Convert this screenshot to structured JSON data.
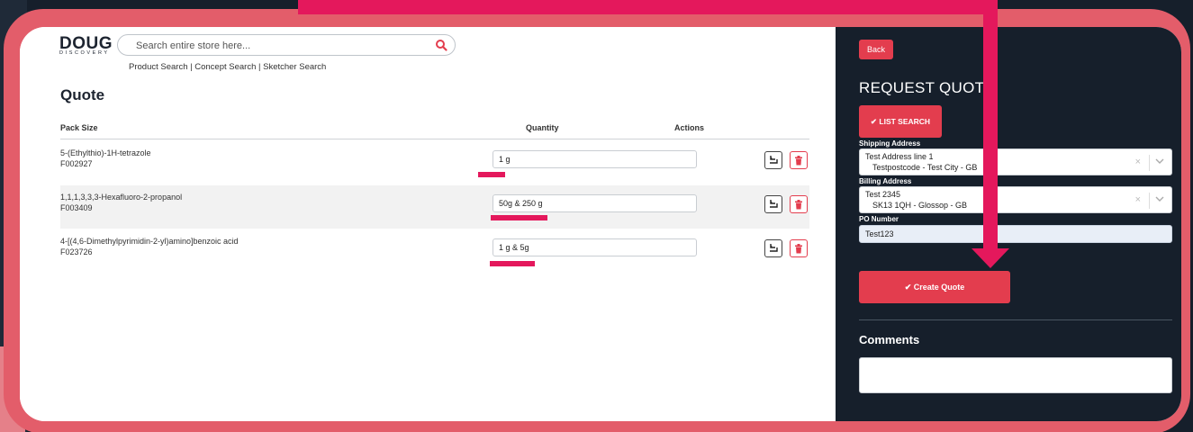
{
  "header": {
    "logo_main": "DOUG",
    "logo_sub": "DISCOVERY",
    "search_placeholder": "Search entire store here...",
    "links": [
      "Product Search",
      "Concept Search",
      "Sketcher Search"
    ],
    "link_separator": "|"
  },
  "quote": {
    "title": "Quote",
    "columns": {
      "pack_size": "Pack Size",
      "quantity": "Quantity",
      "actions": "Actions"
    },
    "items": [
      {
        "name": "5-(Ethylthio)-1H-tetrazole",
        "code": "F002927",
        "quantity": "1 g"
      },
      {
        "name": "1,1,1,3,3,3-Hexafluoro-2-propanol",
        "code": "F003409",
        "quantity": "50g & 250 g"
      },
      {
        "name": "4-[(4,6-Dimethylpyrimidin-2-yl)amino]benzoic acid",
        "code": "F023726",
        "quantity": "1 g & 5g"
      }
    ]
  },
  "sidebar": {
    "back_label": "Back",
    "title": "REQUEST QUOTE",
    "list_search_label": "✔ LIST SEARCH",
    "shipping_label": "Shipping Address",
    "shipping_line1": "Test Address line 1",
    "shipping_line2": "Testpostcode - Test City - GB",
    "billing_label": "Billing Address",
    "billing_line1": "Test 2345",
    "billing_line2": "SK13 1QH - Glossop - GB",
    "po_label": "PO Number",
    "po_value": "Test123",
    "create_label": "✔ Create Quote",
    "comments_title": "Comments"
  },
  "colors": {
    "accent": "#e33d4e",
    "annotation": "#e4185c",
    "dark_bg": "#161f2b",
    "frame": "#e35d6a"
  },
  "icons": [
    "search-icon",
    "restore-icon",
    "trash-icon",
    "chevron-down-icon",
    "clear-icon",
    "check-icon"
  ]
}
